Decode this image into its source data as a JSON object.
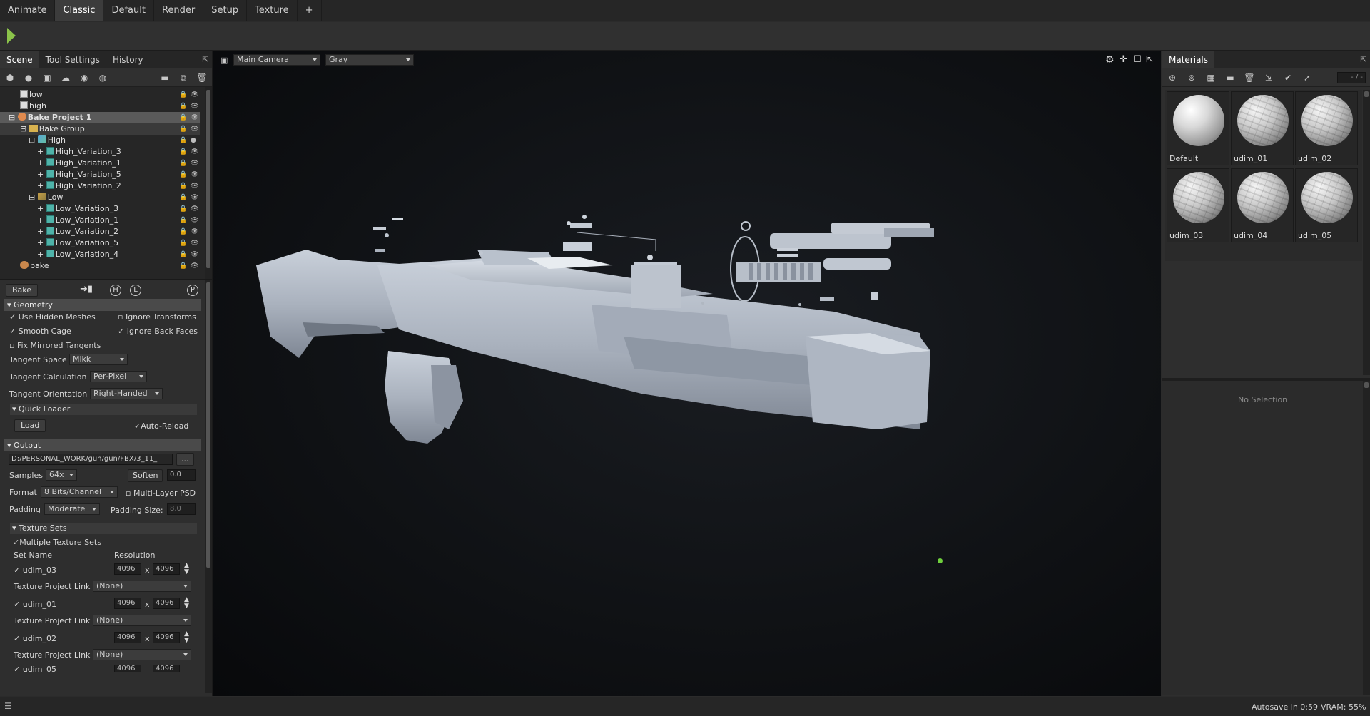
{
  "workspace_tabs": [
    "Animate",
    "Classic",
    "Default",
    "Render",
    "Setup",
    "Texture",
    "+"
  ],
  "workspace_active": "Classic",
  "left_tabs": [
    "Scene",
    "Tool Settings",
    "History"
  ],
  "scene_tree": [
    {
      "label": "low",
      "indent": 0
    },
    {
      "label": "high",
      "indent": 0
    },
    {
      "label": "Bake Project 1",
      "indent": 0
    },
    {
      "label": "Bake Group",
      "indent": 1
    },
    {
      "label": "High",
      "indent": 2
    },
    {
      "label": "High_Variation_3",
      "indent": 3
    },
    {
      "label": "High_Variation_1",
      "indent": 3
    },
    {
      "label": "High_Variation_5",
      "indent": 3
    },
    {
      "label": "High_Variation_2",
      "indent": 3
    },
    {
      "label": "Low",
      "indent": 2
    },
    {
      "label": "Low_Variation_3",
      "indent": 3
    },
    {
      "label": "Low_Variation_1",
      "indent": 3
    },
    {
      "label": "Low_Variation_2",
      "indent": 3
    },
    {
      "label": "Low_Variation_5",
      "indent": 3
    },
    {
      "label": "Low_Variation_4",
      "indent": 3
    },
    {
      "label": "bake",
      "indent": 0
    }
  ],
  "bake": {
    "bake_button": "Bake",
    "h_button": "H",
    "l_button": "L",
    "p_button": "P",
    "geometry_header": "Geometry",
    "use_hidden_meshes": "Use Hidden Meshes",
    "ignore_transforms": "Ignore Transforms",
    "smooth_cage": "Smooth Cage",
    "ignore_back_faces": "Ignore Back Faces",
    "fix_mirrored": "Fix Mirrored Tangents",
    "tangent_space_label": "Tangent Space",
    "tangent_space_value": "Mikk",
    "tangent_calc_label": "Tangent Calculation",
    "tangent_calc_value": "Per-Pixel",
    "tangent_orient_label": "Tangent Orientation",
    "tangent_orient_value": "Right-Handed",
    "quick_loader_header": "Quick Loader",
    "load_button": "Load",
    "auto_reload": "Auto-Reload",
    "output_header": "Output",
    "output_path": "D:/PERSONAL_WORK/gun/gun/FBX/3_11_",
    "browse_button": "...",
    "samples_label": "Samples",
    "samples_value": "64x",
    "soften_label": "Soften",
    "soften_value": "0.0",
    "format_label": "Format",
    "format_value": "8 Bits/Channel",
    "multilayer_psd": "Multi-Layer PSD",
    "padding_label": "Padding",
    "padding_value": "Moderate",
    "padding_size_label": "Padding Size:",
    "padding_size_value": "8.0",
    "texture_sets_header": "Texture Sets",
    "multiple_texture_sets": "Multiple Texture Sets",
    "set_name_col": "Set Name",
    "resolution_col": "Resolution",
    "tpl_label": "Texture Project Link",
    "tpl_value": "(None)",
    "sets": [
      {
        "name": "udim_03",
        "w": "4096",
        "h": "4096"
      },
      {
        "name": "udim_01",
        "w": "4096",
        "h": "4096"
      },
      {
        "name": "udim_02",
        "w": "4096",
        "h": "4096"
      },
      {
        "name": "udim_05",
        "w": "4096",
        "h": "4096"
      }
    ],
    "x_sep": "x"
  },
  "viewport": {
    "camera": "Main Camera",
    "shading": "Gray"
  },
  "materials": {
    "title": "Materials",
    "counter": "- / -",
    "items": [
      {
        "name": "Default",
        "textured": false
      },
      {
        "name": "udim_01",
        "textured": true
      },
      {
        "name": "udim_02",
        "textured": true
      },
      {
        "name": "udim_03",
        "textured": true
      },
      {
        "name": "udim_04",
        "textured": true
      },
      {
        "name": "udim_05",
        "textured": true
      }
    ],
    "no_selection": "No Selection"
  },
  "status": {
    "autosave": "Autosave in 0:59",
    "vram": "VRAM: 55%"
  }
}
